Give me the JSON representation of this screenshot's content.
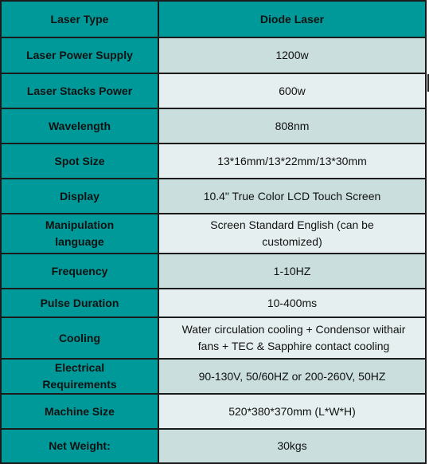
{
  "header": {
    "label": "Laser Type",
    "value": "Diode Laser"
  },
  "rows": [
    {
      "label": "Laser Power Supply",
      "value": "1200w"
    },
    {
      "label": "Laser Stacks Power",
      "value": "600w"
    },
    {
      "label": "Wavelength",
      "value": "808nm"
    },
    {
      "label": "Spot Size",
      "value": "13*16mm/13*22mm/13*30mm"
    },
    {
      "label": "Display",
      "value": "10.4\" True Color LCD Touch Screen"
    },
    {
      "label": "Manipulation language",
      "value": "Screen Standard English (can be customized)"
    },
    {
      "label": "Frequency",
      "value": "1-10HZ"
    },
    {
      "label": "Pulse Duration",
      "value": "10-400ms"
    },
    {
      "label": "Cooling",
      "value": "Water circulation cooling + Condensor withair fans + TEC & Sapphire contact cooling"
    },
    {
      "label": "Electrical Requirements",
      "value": "90-130V, 50/60HZ or 200-260V, 50HZ"
    },
    {
      "label": "Machine Size",
      "value": "520*380*370mm (L*W*H)"
    },
    {
      "label": "Net Weight:",
      "value": "30kgs"
    }
  ],
  "colors": {
    "label_bg": "#009999",
    "value_bg_a": "#c9dedd",
    "value_bg_b": "#e6efef",
    "border": "#1b1b1b"
  }
}
